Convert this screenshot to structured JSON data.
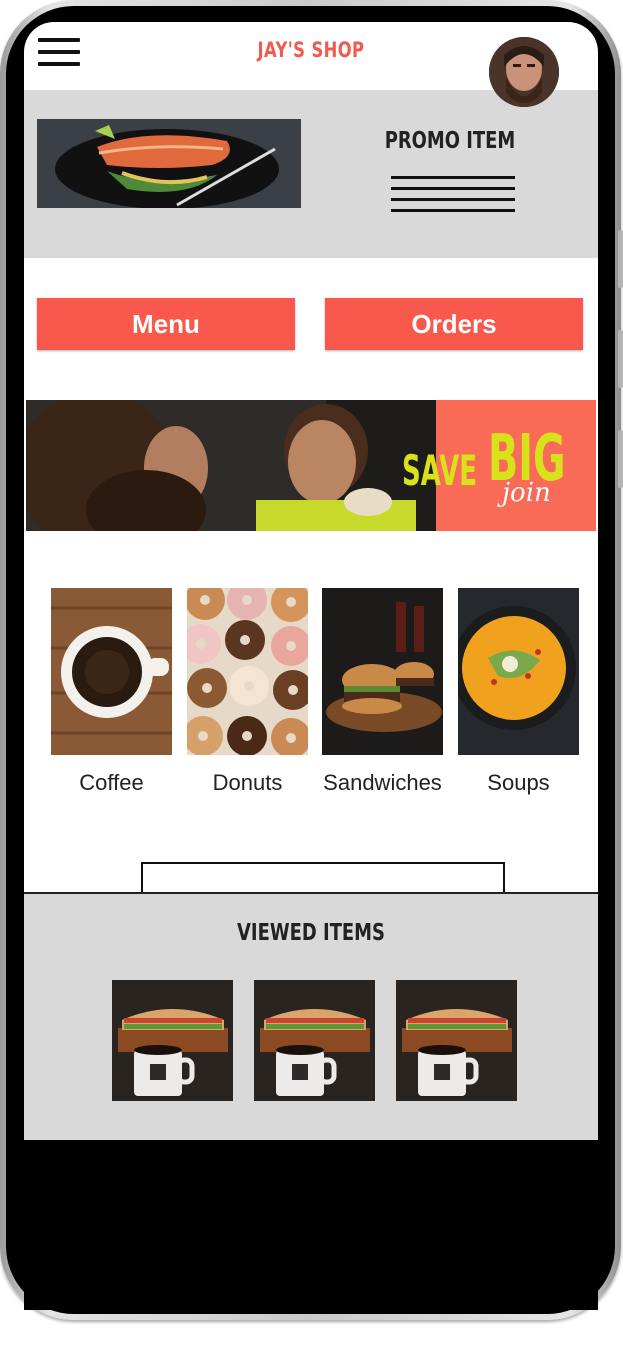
{
  "app": {
    "title": "JAY'S SHOP"
  },
  "header": {
    "menu_icon": "hamburger-menu-icon",
    "avatar": "user-avatar"
  },
  "promo": {
    "title": "PROMO ITEM",
    "image": "salmon-dish-photo"
  },
  "actions": {
    "menu_label": "Menu",
    "orders_label": "Orders"
  },
  "banner": {
    "save_text": "SAVE",
    "big_text": "BIG",
    "join_text": "join",
    "image": "couple-eating-photo"
  },
  "categories": [
    {
      "label": "Coffee",
      "image": "coffee-cup-photo"
    },
    {
      "label": "Donuts",
      "image": "donuts-photo"
    },
    {
      "label": "Sandwiches",
      "image": "burgers-photo"
    },
    {
      "label": "Soups",
      "image": "soup-bowl-photo"
    }
  ],
  "viewed": {
    "title": "VIEWED ITEMS",
    "items": [
      "sandwich-and-coffee-photo",
      "sandwich-and-coffee-photo",
      "sandwich-and-coffee-photo"
    ]
  },
  "colors": {
    "accent": "#f9594c",
    "title_red": "#f25a4d",
    "panel_gray": "#d9d9d9",
    "banner_orange": "#f96b56",
    "banner_yellow": "#d8e21b"
  }
}
